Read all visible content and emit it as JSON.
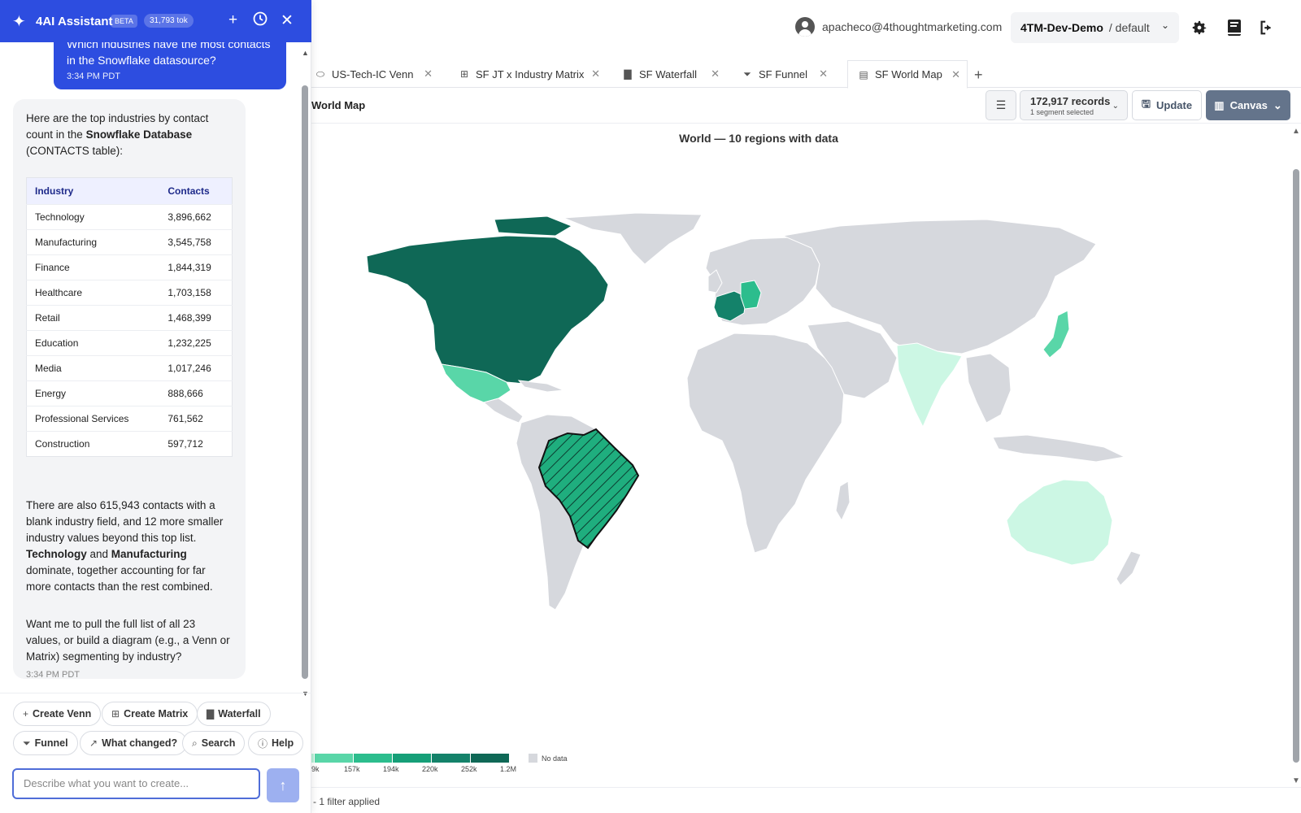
{
  "topbar": {
    "user_email": "apacheco@4thoughtmarketing.com",
    "workspace": "4TM-Dev-Demo",
    "workspace_sub": "/ default"
  },
  "tabs": [
    {
      "label": "US-Tech-IC Venn",
      "icon": "venn-icon"
    },
    {
      "label": "SF JT x Industry Matrix",
      "icon": "grid-icon"
    },
    {
      "label": "SF Waterfall",
      "icon": "bar-chart-icon"
    },
    {
      "label": "SF Funnel",
      "icon": "funnel-icon"
    },
    {
      "label": "SF World Map",
      "icon": "map-icon",
      "active": true
    }
  ],
  "subbar": {
    "breadcrumb": "World Map",
    "records": "172,917 records",
    "segment": "1 segment selected",
    "update_label": "Update",
    "canvas_label": "Canvas"
  },
  "map": {
    "title": "World — 10 regions with data",
    "regions_with_data": [
      "North America",
      "Mexico",
      "France",
      "Germany",
      "Brazil",
      "India",
      "Japan",
      "Australia"
    ],
    "highlighted_region": "Brazil",
    "legend": {
      "labels": [
        "9k",
        "157k",
        "194k",
        "220k",
        "252k",
        "1.2M"
      ],
      "no_data_label": "No data",
      "colors": [
        "#b7f0d8",
        "#59d6a8",
        "#2cbd8d",
        "#169f78",
        "#14826a",
        "#0f6856"
      ]
    }
  },
  "status": {
    "filter_text": "- 1 filter applied"
  },
  "assistant": {
    "title": "4AI Assistant",
    "beta": "BETA",
    "tokens": "31,793 tok",
    "user_message": "Which industries have the most contacts in the Snowflake datasource?",
    "user_time": "3:34 PM PDT",
    "bot_intro_a": "Here are the top industries by contact count in the ",
    "bot_intro_bold": "Snowflake Database",
    "bot_intro_b": " (CONTACTS table):",
    "table_headers": [
      "Industry",
      "Contacts"
    ],
    "table_rows": [
      [
        "Technology",
        "3,896,662"
      ],
      [
        "Manufacturing",
        "3,545,758"
      ],
      [
        "Finance",
        "1,844,319"
      ],
      [
        "Healthcare",
        "1,703,158"
      ],
      [
        "Retail",
        "1,468,399"
      ],
      [
        "Education",
        "1,232,225"
      ],
      [
        "Media",
        "1,017,246"
      ],
      [
        "Energy",
        "888,666"
      ],
      [
        "Professional Services",
        "761,562"
      ],
      [
        "Construction",
        "597,712"
      ]
    ],
    "bot_p2_a": "There are also 615,943 contacts with a blank industry field, and 12 more smaller industry values beyond this top list. ",
    "bot_p2_b1": "Technology",
    "bot_p2_and": " and ",
    "bot_p2_b2": "Manufacturing",
    "bot_p2_c": " dominate, together accounting for far more contacts than the rest combined.",
    "bot_p3": "Want me to pull the full list of all 23 values, or build a diagram (e.g., a Venn or Matrix) segmenting by industry?",
    "bot_time": "3:34 PM PDT",
    "chips": [
      {
        "label": "Create Venn",
        "icon": "plus-icon"
      },
      {
        "label": "Create Matrix",
        "icon": "grid-icon"
      },
      {
        "label": "Waterfall",
        "icon": "bar-chart-icon"
      },
      {
        "label": "Funnel",
        "icon": "funnel-icon"
      },
      {
        "label": "What changed?",
        "icon": "trend-icon"
      },
      {
        "label": "Search",
        "icon": "search-icon"
      },
      {
        "label": "Help",
        "icon": "help-icon"
      }
    ],
    "composer_placeholder": "Describe what you want to create..."
  }
}
